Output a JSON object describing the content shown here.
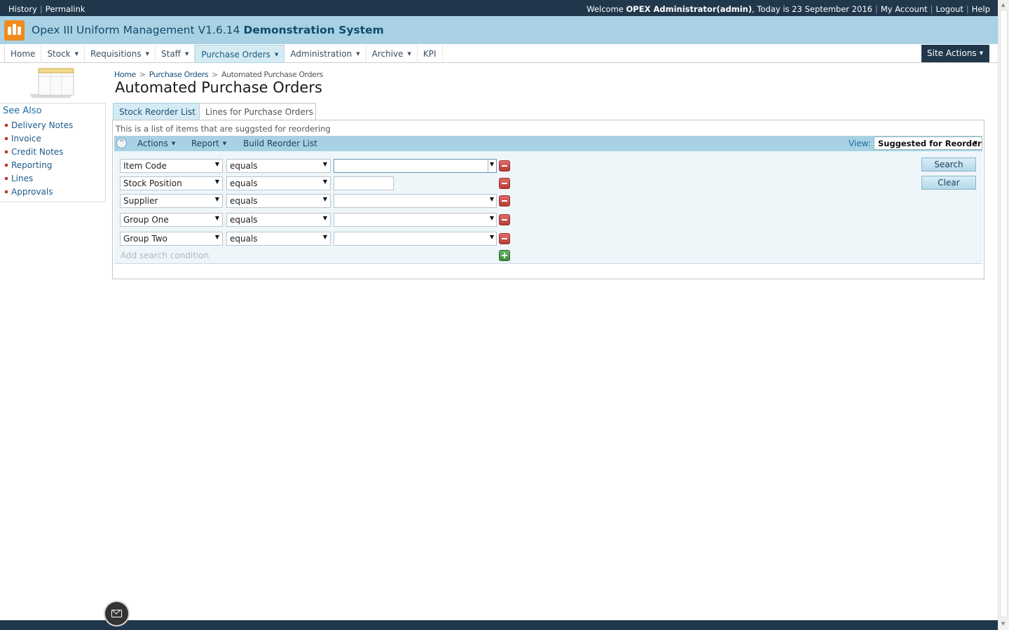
{
  "topbar": {
    "history": "History",
    "permalink": "Permalink",
    "welcome_prefix": "Welcome ",
    "user": "OPEX Administrator(admin)",
    "today": ", Today is 23 September 2016",
    "my_account": "My Account",
    "logout": "Logout",
    "help": "Help"
  },
  "app": {
    "title_main": "Opex III Uniform Management V1.6.14",
    "title_bold": "Demonstration System",
    "logo_color": "#f08a1c"
  },
  "nav": {
    "items": [
      {
        "label": "Home",
        "dropdown": false
      },
      {
        "label": "Stock",
        "dropdown": true
      },
      {
        "label": "Requisitions",
        "dropdown": true
      },
      {
        "label": "Staff",
        "dropdown": true
      },
      {
        "label": "Purchase Orders",
        "dropdown": true,
        "active": true
      },
      {
        "label": "Administration",
        "dropdown": true
      },
      {
        "label": "Archive",
        "dropdown": true
      },
      {
        "label": "KPI",
        "dropdown": false
      }
    ],
    "site_actions": "Site Actions",
    "caret": "▼"
  },
  "see_also": {
    "title": "See Also",
    "links": [
      "Delivery Notes",
      "Invoice",
      "Credit Notes",
      "Reporting",
      "Lines",
      "Approvals"
    ]
  },
  "breadcrumb": {
    "home": "Home",
    "purchase_orders": "Purchase Orders",
    "current": "Automated Purchase Orders",
    "separator": ">"
  },
  "page_title": "Automated Purchase Orders",
  "tabs": {
    "stock_reorder": "Stock Reorder List",
    "lines_for_po": "Lines for Purchase Orders"
  },
  "panel": {
    "description": "This is a list of items that are suggsted for reordering",
    "collapse_glyph": "^",
    "actions": "Actions",
    "report": "Report",
    "build": "Build Reorder List",
    "view_label": "View:",
    "view_value": "Suggested for Reorder"
  },
  "search": {
    "conditions": [
      {
        "field": "Item Code",
        "operator": "equals",
        "value": ""
      },
      {
        "field": "Stock Position",
        "operator": "equals",
        "value": ""
      },
      {
        "field": "Supplier",
        "operator": "equals",
        "value": ""
      },
      {
        "field": "Group One",
        "operator": "equals",
        "value": ""
      },
      {
        "field": "Group Two",
        "operator": "equals",
        "value": ""
      }
    ],
    "add_condition": "Add search condition",
    "search_button": "Search",
    "clear_button": "Clear"
  },
  "icons": {
    "dropdown_arrow": "▼",
    "scroll_up": "▲",
    "scroll_down": "▼"
  }
}
